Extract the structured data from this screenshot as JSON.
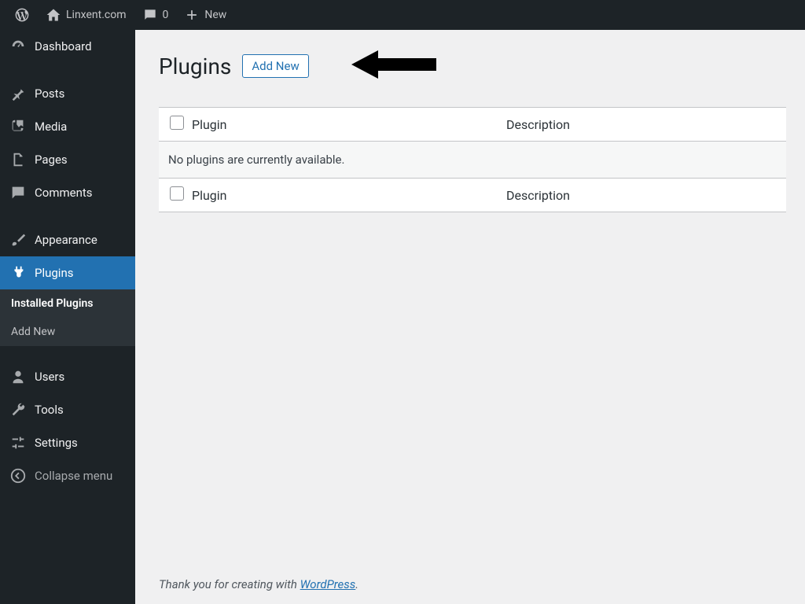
{
  "topbar": {
    "site_name": "Linxent.com",
    "comments_count": "0",
    "new_label": "New"
  },
  "sidebar": {
    "dashboard": "Dashboard",
    "posts": "Posts",
    "media": "Media",
    "pages": "Pages",
    "comments": "Comments",
    "appearance": "Appearance",
    "plugins": "Plugins",
    "users": "Users",
    "tools": "Tools",
    "settings": "Settings",
    "collapse": "Collapse menu",
    "submenu": {
      "installed": "Installed Plugins",
      "add_new": "Add New"
    }
  },
  "main": {
    "title": "Plugins",
    "add_new_btn": "Add New",
    "col_plugin": "Plugin",
    "col_description": "Description",
    "empty": "No plugins are currently available."
  },
  "footer": {
    "prefix": "Thank you for creating with ",
    "link": "WordPress",
    "suffix": "."
  }
}
